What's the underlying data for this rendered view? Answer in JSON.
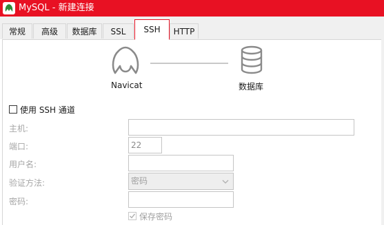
{
  "window": {
    "title": "MySQL - 新建连接"
  },
  "tabs": [
    {
      "label": "常规"
    },
    {
      "label": "高级"
    },
    {
      "label": "数据库"
    },
    {
      "label": "SSL"
    },
    {
      "label": "SSH",
      "active": true
    },
    {
      "label": "HTTP"
    }
  ],
  "diagram": {
    "left_label": "Navicat",
    "right_label": "数据库",
    "left_icon": "navicat-icon",
    "right_icon": "database-icon"
  },
  "ssh": {
    "use_tunnel_label": "使用 SSH 通道",
    "use_tunnel_checked": false,
    "host_label": "主机:",
    "host_value": "",
    "port_label": "端口:",
    "port_value": "22",
    "username_label": "用户名:",
    "username_value": "",
    "auth_label": "验证方法:",
    "auth_value": "密码",
    "password_label": "密码:",
    "password_value": "",
    "save_password_label": "保存密码",
    "save_password_checked": true
  },
  "colors": {
    "titlebar": "#e81123",
    "accent": "#e81123",
    "disabled_text": "#a6a6a6"
  }
}
